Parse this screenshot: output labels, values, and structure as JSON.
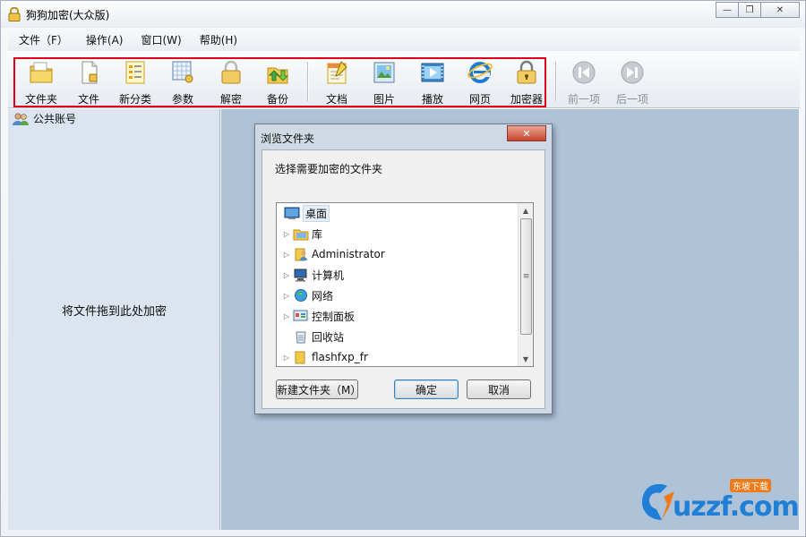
{
  "window": {
    "title": "狗狗加密(大众版)",
    "controls": [
      "minimize",
      "restore",
      "close"
    ]
  },
  "menu": [
    {
      "label": "文件（F）"
    },
    {
      "label": "操作(A)"
    },
    {
      "label": "窗口(W)"
    },
    {
      "label": "帮助(H)"
    }
  ],
  "toolbar": {
    "items": [
      {
        "label": "文件夹",
        "icon": "folder-icon"
      },
      {
        "label": "文件",
        "icon": "file-icon"
      },
      {
        "label": "新分类",
        "icon": "category-icon"
      },
      {
        "label": "参数",
        "icon": "settings-grid-icon"
      },
      {
        "label": "解密",
        "icon": "unlock-icon"
      },
      {
        "label": "备份",
        "icon": "backup-icon"
      },
      {
        "label": "文档",
        "icon": "document-icon"
      },
      {
        "label": "图片",
        "icon": "picture-icon"
      },
      {
        "label": "播放",
        "icon": "video-icon"
      },
      {
        "label": "网页",
        "icon": "ie-icon"
      },
      {
        "label": "加密器",
        "icon": "lock-icon"
      }
    ],
    "nav": [
      {
        "label": "前一项",
        "icon": "previous-icon",
        "disabled": true
      },
      {
        "label": "后一项",
        "icon": "next-icon",
        "disabled": true
      }
    ]
  },
  "sidebar": {
    "account_label": "公共账号",
    "drop_hint": "将文件拖到此处加密"
  },
  "dialog": {
    "title": "浏览文件夹",
    "prompt": "选择需要加密的文件夹",
    "tree": [
      {
        "label": "桌面",
        "icon": "desktop-icon",
        "expandable": false,
        "selected": true
      },
      {
        "label": "库",
        "icon": "library-icon",
        "expandable": true
      },
      {
        "label": "Administrator",
        "icon": "user-folder-icon",
        "expandable": true
      },
      {
        "label": "计算机",
        "icon": "computer-icon",
        "expandable": true
      },
      {
        "label": "网络",
        "icon": "network-icon",
        "expandable": true
      },
      {
        "label": "控制面板",
        "icon": "control-panel-icon",
        "expandable": true
      },
      {
        "label": "回收站",
        "icon": "recycle-bin-icon",
        "expandable": false
      },
      {
        "label": "flashfxp_fr",
        "icon": "folder-icon",
        "expandable": true
      }
    ],
    "buttons": {
      "new_folder": "新建文件夹（M）",
      "ok": "确定",
      "cancel": "取消"
    }
  },
  "watermark": {
    "text": "uzzf.com",
    "badge": "东坡下载"
  }
}
